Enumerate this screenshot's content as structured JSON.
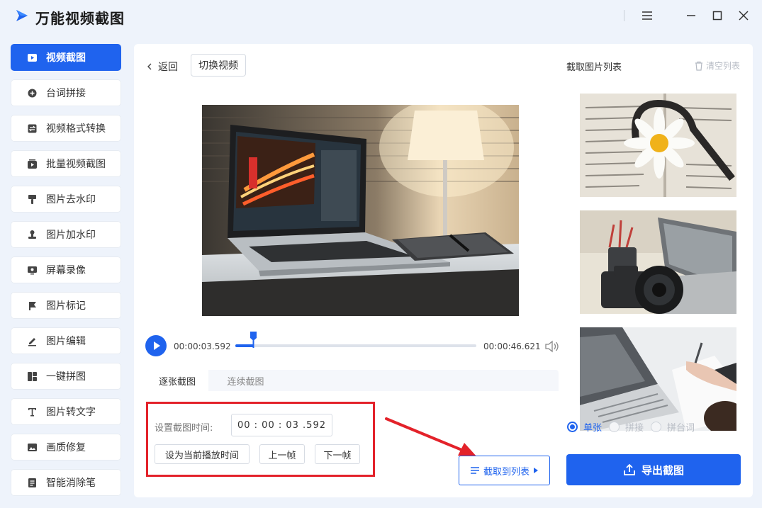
{
  "app": {
    "title": "万能视频截图"
  },
  "sidebar": {
    "items": [
      {
        "label": "视频截图",
        "icon": "video-capture-icon",
        "active": true
      },
      {
        "label": "台词拼接",
        "icon": "plus-circle-icon"
      },
      {
        "label": "视频格式转换",
        "icon": "convert-icon"
      },
      {
        "label": "批量视频截图",
        "icon": "batch-capture-icon"
      },
      {
        "label": "图片去水印",
        "icon": "brush-icon"
      },
      {
        "label": "图片加水印",
        "icon": "stamp-icon"
      },
      {
        "label": "屏幕录像",
        "icon": "screen-record-icon"
      },
      {
        "label": "图片标记",
        "icon": "flag-icon"
      },
      {
        "label": "图片编辑",
        "icon": "pen-icon"
      },
      {
        "label": "一键拼图",
        "icon": "collage-icon"
      },
      {
        "label": "图片转文字",
        "icon": "text-icon"
      },
      {
        "label": "画质修复",
        "icon": "image-icon"
      },
      {
        "label": "智能消除笔",
        "icon": "eraser-icon"
      }
    ]
  },
  "toolbar": {
    "back_label": "返回",
    "switch_label": "切换视频"
  },
  "player": {
    "current_time": "00:00:03.592",
    "total_time": "00:00:46.621",
    "progress": 0.077
  },
  "tabs": [
    {
      "label": "逐张截图"
    },
    {
      "label": "连续截图"
    }
  ],
  "capture": {
    "time_label": "设置截图时间:",
    "time_value": "00 : 00 : 03 .592",
    "set_current_label": "设为当前播放时间",
    "prev_frame_label": "上一帧",
    "next_frame_label": "下一帧",
    "add_to_list_label": "截取到列表"
  },
  "right_panel": {
    "title": "截取图片列表",
    "clear_label": "清空列表",
    "modes": [
      {
        "label": "单张",
        "selected": true
      },
      {
        "label": "拼接"
      },
      {
        "label": "拼台词"
      }
    ],
    "export_label": "导出截图"
  },
  "colors": {
    "accent": "#1f63ee",
    "highlight_red": "#e3222a"
  }
}
